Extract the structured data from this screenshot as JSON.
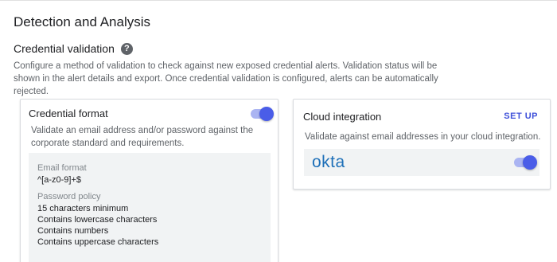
{
  "header": {
    "title": "Detection and Analysis"
  },
  "credential_validation": {
    "title": "Credential validation",
    "help_icon": "question-mark-icon",
    "description": "Configure a method of validation to check against new exposed credential alerts. Validation status will be shown in the alert details and export. Once credential validation is configured, alerts can be automatically rejected."
  },
  "credential_format": {
    "title": "Credential format",
    "toggle_on": true,
    "description": "Validate an email address and/or password against the corporate standard and requirements.",
    "email_format_label": "Email format",
    "email_format_value": "^[a-z0-9]+$",
    "password_policy_label": "Password policy",
    "password_policy_items": [
      "15 characters minimum",
      "Contains lowercase characters",
      "Contains numbers",
      "Contains uppercase characters"
    ]
  },
  "cloud_integration": {
    "title": "Cloud integration",
    "setup_label": "SET UP",
    "description": "Validate against email addresses in your cloud integration.",
    "provider_logo_text": "okta",
    "provider_toggle_on": true
  },
  "colors": {
    "accent": "#4a5de8",
    "accent_track": "#aab4f2",
    "okta_blue": "#1d6fb8",
    "panel_bg": "#f1f3f4"
  }
}
